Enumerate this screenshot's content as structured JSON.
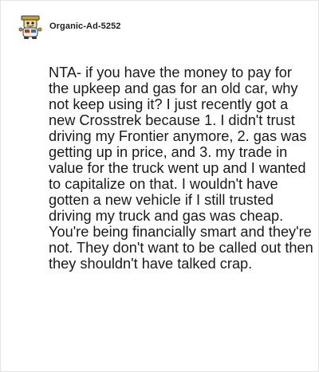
{
  "comment": {
    "author": "Organic-Ad-5252",
    "avatar_icon": "snoo-avatar-icon",
    "body": "NTA- if you have the money to pay for the upkeep and gas for an old car, why not keep using it? I just recently got a new Crosstrek because 1. I didn't trust driving my Frontier anymore, 2. gas was getting up in price, and 3. my trade in value for the truck went up and I wanted to capitalize on that. I wouldn't have gotten a new vehicle if I still trusted driving my truck and gas was cheap. You're being financially smart and they're not. They don't want to be called out then they shouldn't have talked crap."
  },
  "colors": {
    "text": "#1a1a1a",
    "border": "#e4e4e4",
    "avatar_accent": "#c9a227"
  }
}
